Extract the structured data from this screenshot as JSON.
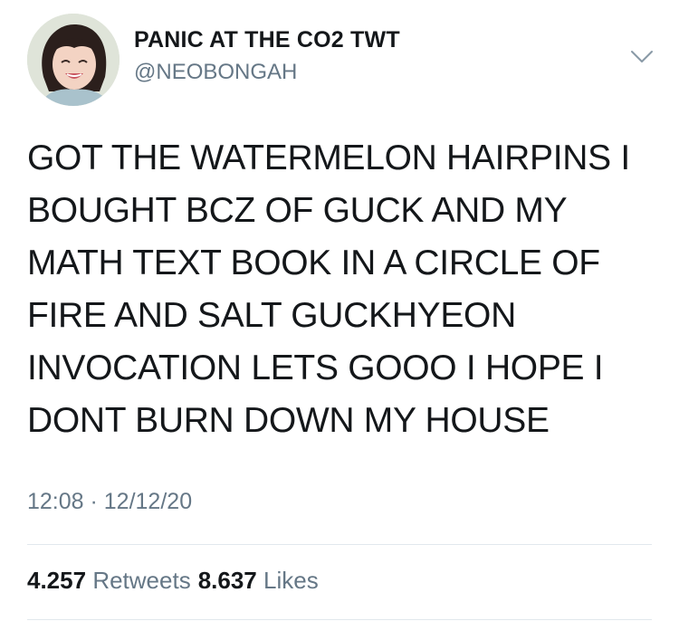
{
  "user": {
    "display_name": "PANIC AT THE CO2 TWT",
    "handle": "@NEOBONGAH",
    "avatar_icon": "profile-photo"
  },
  "tweet": {
    "lines": [
      "GOT THE WATERMELON HAIRPINS I",
      "BOUGHT BCZ OF GUCK AND MY",
      "MATH TEXT BOOK IN A CIRCLE OF",
      "FIRE AND SALT GUCKHYEON",
      "INVOCATION LETS GOOO I HOPE I",
      "DONT BURN DOWN MY HOUSE"
    ],
    "timestamp": "12:08 · 12/12/20"
  },
  "stats": {
    "retweets_count": "4.257",
    "retweets_label": "Retweets",
    "likes_count": "8.637",
    "likes_label": "Likes"
  },
  "icons": {
    "menu": "chevron-down-icon"
  },
  "colors": {
    "text": "#14171a",
    "secondary": "#657786",
    "divider": "#e1e8ed"
  }
}
